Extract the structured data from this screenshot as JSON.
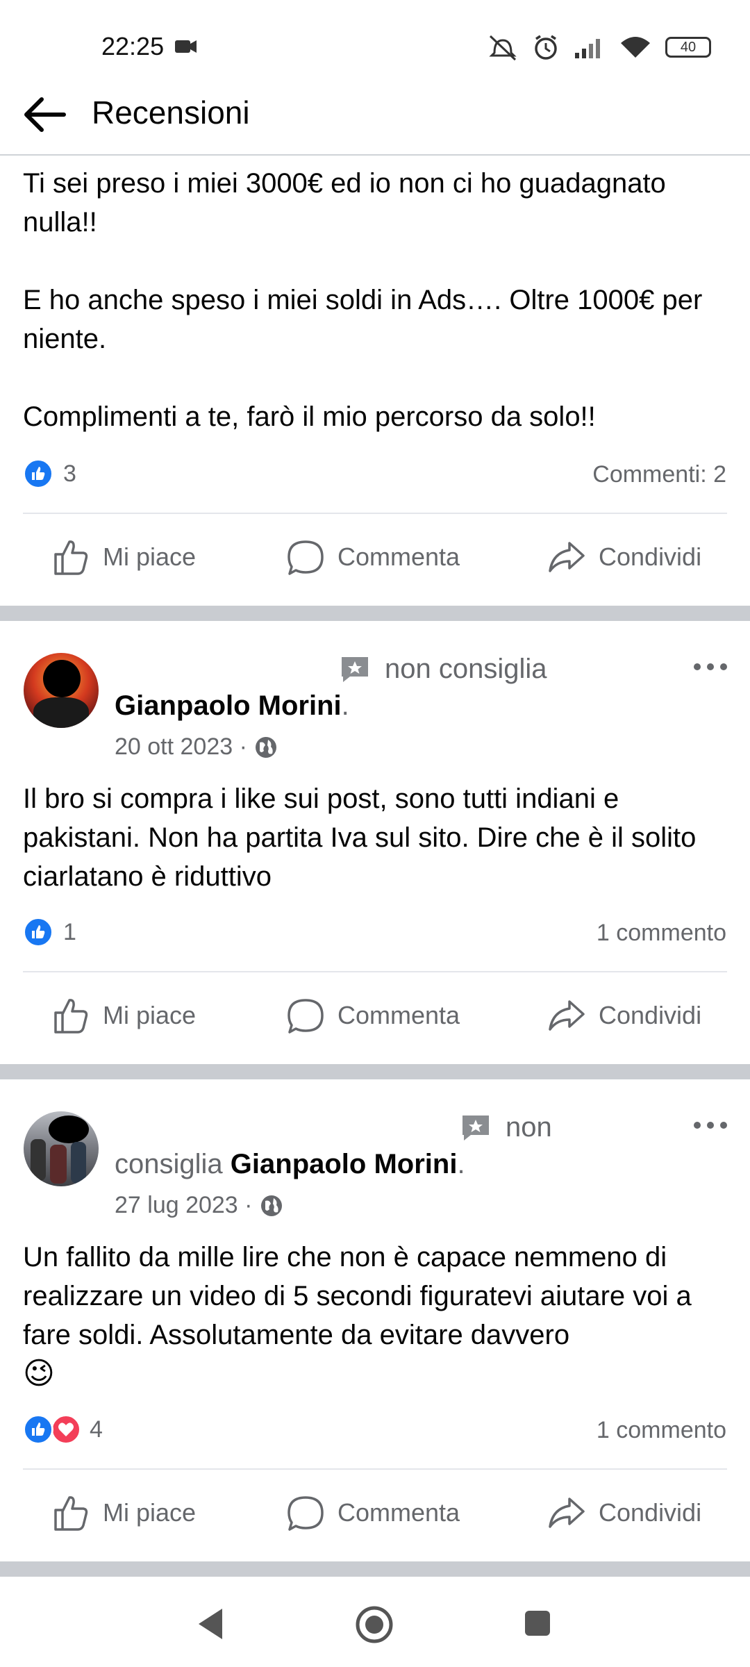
{
  "status_bar": {
    "time": "22:25",
    "battery": "40"
  },
  "header": {
    "title": "Recensioni"
  },
  "post1": {
    "text": "Ti sei preso i miei 3000€ ed io non ci ho guadagnato nulla!!\n\nE ho anche speso i miei soldi in Ads…. Oltre 1000€ per niente.\n\nComplimenti a te, farò il mio percorso da solo!!",
    "reactions": "3",
    "comments": "Commenti: 2"
  },
  "post2": {
    "recommendation": "non consiglia",
    "author": "Gianpaolo Morini",
    "date": "20 ott 2023 ·",
    "text": "Il bro si compra i like sui post, sono tutti indiani e pakistani. Non ha partita Iva sul sito. Dire che è il solito ciarlatano è riduttivo",
    "reactions": "1",
    "comments": "1 commento"
  },
  "post3": {
    "recommendation_1": "non",
    "recommendation_2": "consiglia",
    "author": "Gianpaolo Morini",
    "date": "27 lug 2023 ·",
    "text": "Un fallito da mille lire che non è capace nemmeno di realizzare un video di 5 secondi figuratevi aiutare voi a fare soldi. Assolutamente da evitare davvero",
    "emoji": "😉",
    "reactions": "4",
    "comments": "1 commento"
  },
  "actions": {
    "like": "Mi piace",
    "comment": "Commenta",
    "share": "Condividi"
  },
  "colors": {
    "like_blue": "#1877f2",
    "love_red": "#f33e58",
    "muted": "#65676b",
    "separator": "#c9ccd1"
  },
  "icons": [
    "back-arrow-icon",
    "thumbs-up-icon",
    "comment-icon",
    "share-icon",
    "review-star-icon",
    "globe-icon",
    "more-icon",
    "nav-back-icon",
    "nav-home-icon",
    "nav-recents-icon"
  ]
}
